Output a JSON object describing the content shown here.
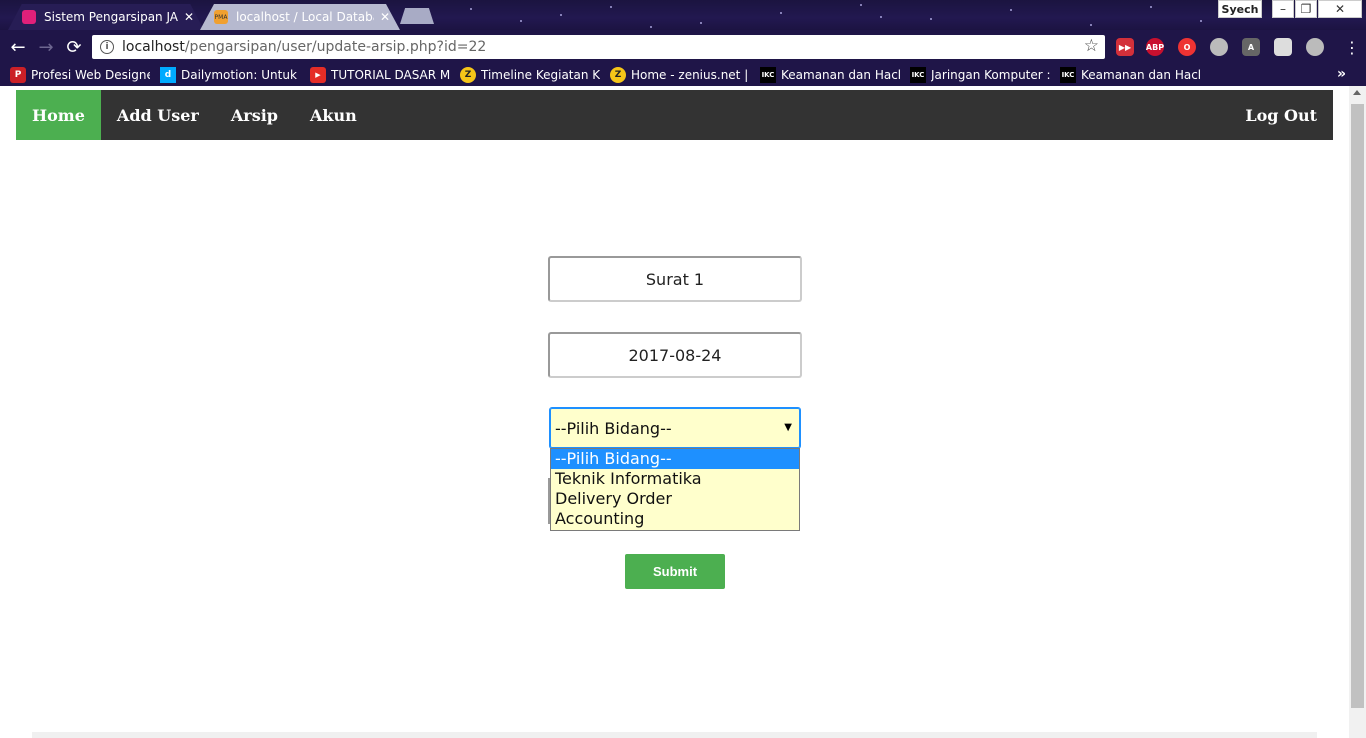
{
  "browser": {
    "tabs": [
      {
        "label": "Sistem Pengarsipan JAPF",
        "active": true,
        "favicon_color": "#e0207a"
      },
      {
        "label": "localhost / Local Databa",
        "active": false,
        "favicon_text": "PMA"
      }
    ],
    "profile_name": "Syech",
    "window_controls": {
      "minimize": "–",
      "restore": "❐",
      "close": "✕"
    },
    "url": {
      "host": "localhost",
      "path": "/pengarsipan/user/update-arsip.php?id=22"
    },
    "extensions": [
      "ABP"
    ],
    "bookmarks": [
      {
        "label": "Profesi Web Designer",
        "icon": "pinterest-icon",
        "color": "#cb2027",
        "icon_text": "P"
      },
      {
        "label": "Dailymotion: Untuk D",
        "icon": "dailymotion-icon",
        "color": "#00aaff",
        "icon_text": "d"
      },
      {
        "label": "TUTORIAL DASAR ME",
        "icon": "youtube-icon",
        "color": "#e52d27",
        "icon_text": "▶"
      },
      {
        "label": "Timeline Kegiatan Kel",
        "icon": "zenius-icon",
        "color": "#f5c518",
        "icon_text": "Z"
      },
      {
        "label": "Home - zenius.net | T",
        "icon": "zenius-icon",
        "color": "#f5c518",
        "icon_text": "Z"
      },
      {
        "label": "Keamanan dan Hackir",
        "icon": "ikc-icon",
        "color": "#000000",
        "icon_text": "IKC"
      },
      {
        "label": "Jaringan Komputer : I",
        "icon": "ikc-icon",
        "color": "#000000",
        "icon_text": "IKC"
      },
      {
        "label": "Keamanan dan Hackir",
        "icon": "ikc-icon",
        "color": "#000000",
        "icon_text": "IKC"
      }
    ],
    "more_bookmarks": "»"
  },
  "nav": {
    "items": [
      {
        "label": "Home",
        "active": true
      },
      {
        "label": "Add User",
        "active": false
      },
      {
        "label": "Arsip",
        "active": false
      },
      {
        "label": "Akun",
        "active": false
      }
    ],
    "logout": "Log Out"
  },
  "form": {
    "title_value": "Surat 1",
    "date_value": "2017-08-24",
    "bidang_selected": "--Pilih Bidang--",
    "bidang_options": [
      "--Pilih Bidang--",
      "Teknik Informatika",
      "Delivery Order",
      "Accounting"
    ],
    "submit_label": "Submit"
  },
  "colors": {
    "accent": "#4caf50",
    "nav_bg": "#333333",
    "select_bg": "#ffffcc",
    "highlight": "#1e90ff"
  }
}
